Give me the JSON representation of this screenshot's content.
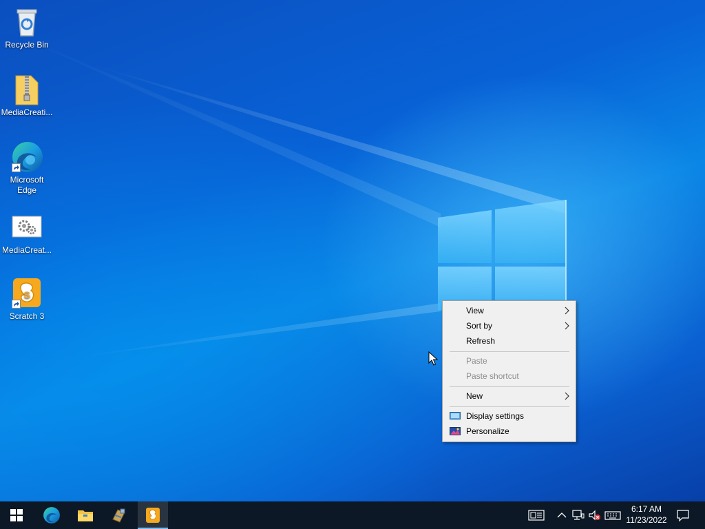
{
  "desktop": {
    "icons": [
      {
        "label": "Recycle Bin",
        "icon": "recycle-bin-icon"
      },
      {
        "label": "MediaCreati...",
        "icon": "zip-folder-icon"
      },
      {
        "label": "Microsoft Edge",
        "icon": "edge-icon"
      },
      {
        "label": "MediaCreat...",
        "icon": "setup-app-icon"
      },
      {
        "label": "Scratch 3",
        "icon": "scratch-icon"
      }
    ]
  },
  "context_menu": {
    "items": [
      {
        "label": "View",
        "submenu": true,
        "enabled": true
      },
      {
        "label": "Sort by",
        "submenu": true,
        "enabled": true
      },
      {
        "label": "Refresh",
        "submenu": false,
        "enabled": true
      },
      {
        "label": "Paste",
        "submenu": false,
        "enabled": false
      },
      {
        "label": "Paste shortcut",
        "submenu": false,
        "enabled": false
      },
      {
        "label": "New",
        "submenu": true,
        "enabled": true
      },
      {
        "label": "Display settings",
        "icon": "display-settings-icon",
        "enabled": true
      },
      {
        "label": "Personalize",
        "icon": "personalize-icon",
        "enabled": true
      }
    ]
  },
  "taskbar": {
    "pinned": [
      {
        "icon": "start-icon"
      },
      {
        "icon": "edge-icon"
      },
      {
        "icon": "file-explorer-icon"
      },
      {
        "icon": "setup-app-icon"
      },
      {
        "icon": "scratch-icon",
        "active": true
      }
    ],
    "tray": {
      "icons": [
        "news-widget-icon",
        "chevron-up-icon",
        "network-icon",
        "volume-muted-icon",
        "keyboard-icon",
        "notification-icon"
      ],
      "time": "6:17 AM",
      "date": "11/23/2022"
    }
  },
  "colors": {
    "taskbar": "#0c1826",
    "menu_bg": "#f0f0f0",
    "accent": "#76b9ed"
  }
}
